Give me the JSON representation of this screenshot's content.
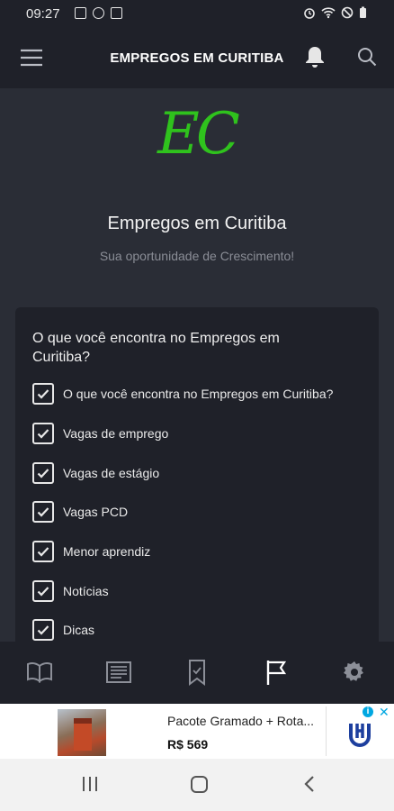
{
  "status_bar": {
    "time": "09:27"
  },
  "app_bar": {
    "title": "EMPREGOS EM CURITIBA"
  },
  "hero": {
    "logo_text": "EC",
    "site_name": "Empregos em Curitiba",
    "tagline": "Sua oportunidade de Crescimento!"
  },
  "card": {
    "title": "O que você encontra no Empregos em Curitiba?",
    "items": [
      {
        "label": "O que você encontra no Empregos em Curitiba?",
        "checked": true
      },
      {
        "label": "Vagas de emprego",
        "checked": true
      },
      {
        "label": "Vagas de estágio",
        "checked": true
      },
      {
        "label": "Vagas PCD",
        "checked": true
      },
      {
        "label": "Menor aprendiz",
        "checked": true
      },
      {
        "label": "Notícias",
        "checked": true
      },
      {
        "label": "Dicas",
        "checked": true
      }
    ]
  },
  "bottom_nav": {
    "items": [
      {
        "icon": "book-icon"
      },
      {
        "icon": "newspaper-icon"
      },
      {
        "icon": "bookmark-icon"
      },
      {
        "icon": "flag-icon",
        "active": true
      },
      {
        "icon": "gear-icon"
      }
    ]
  },
  "ad": {
    "title": "Pacote Gramado + Rota...",
    "price": "R$ 569"
  },
  "colors": {
    "background": "#2a2d36",
    "bar": "#1f2129",
    "logo_green": "#2fc21d"
  }
}
